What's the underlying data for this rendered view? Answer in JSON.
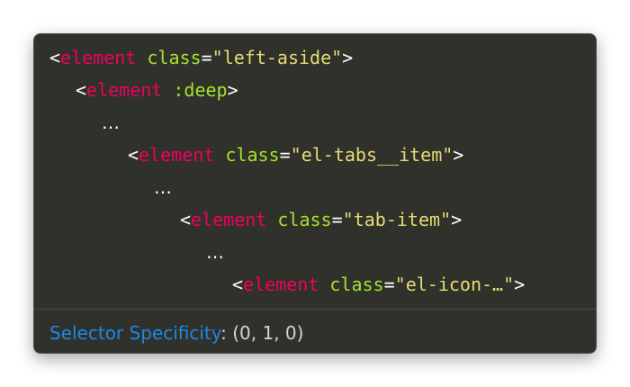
{
  "tooltip": {
    "lines": [
      {
        "open": "<",
        "tag": "element",
        "space": " ",
        "attr": "class",
        "eq": "=",
        "value": "\"left-aside\"",
        "close": ">"
      },
      {
        "open": "<",
        "tag": "element",
        "space": " ",
        "attr": ":deep",
        "close": ">"
      },
      {
        "ellipsis": "…"
      },
      {
        "open": "<",
        "tag": "element",
        "space": " ",
        "attr": "class",
        "eq": "=",
        "value": "\"el-tabs__item\"",
        "close": ">"
      },
      {
        "ellipsis": "…"
      },
      {
        "open": "<",
        "tag": "element",
        "space": " ",
        "attr": "class",
        "eq": "=",
        "value": "\"tab-item\"",
        "close": ">"
      },
      {
        "ellipsis": "…"
      },
      {
        "open": "<",
        "tag": "element",
        "space": " ",
        "attr": "class",
        "eq": "=",
        "value": "\"el-icon-…\"",
        "close": ">"
      }
    ],
    "footer": {
      "label": "Selector Specificity",
      "separator": ": ",
      "value": "(0, 1, 0)"
    }
  },
  "colors": {
    "background": "#2f312a",
    "tag": "#f0005d",
    "attribute": "#a6e22e",
    "string": "#e6db74",
    "footer_label": "#1e88e5"
  }
}
